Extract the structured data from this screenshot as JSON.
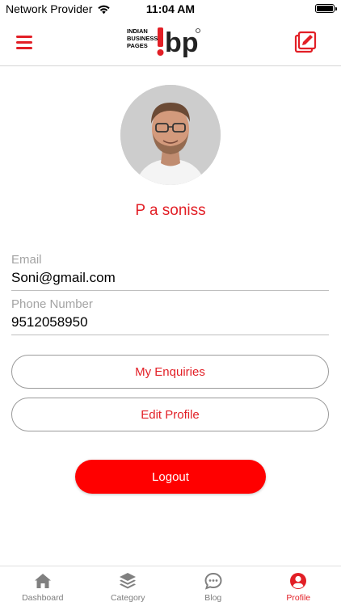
{
  "status_bar": {
    "carrier": "Network Provider",
    "time": "11:04 AM"
  },
  "header": {
    "logo_text_small": [
      "INDIAN",
      "BUSINESS",
      "PAGES"
    ],
    "logo_text_big": "!bp",
    "menu_icon": "hamburger-menu-icon",
    "edit_icon": "edit-square-icon",
    "brand_color": "#e21f26"
  },
  "profile": {
    "name": "P a soniss",
    "email_label": "Email",
    "email_value": "Soni@gmail.com",
    "phone_label": "Phone Number",
    "phone_value": "9512058950"
  },
  "buttons": {
    "enquiries": "My Enquiries",
    "edit_profile": "Edit Profile",
    "logout": "Logout",
    "logout_color": "#ff0000"
  },
  "tabs": [
    {
      "label": "Dashboard",
      "icon": "home-icon"
    },
    {
      "label": "Category",
      "icon": "layers-icon"
    },
    {
      "label": "Blog",
      "icon": "chat-bubble-icon"
    },
    {
      "label": "Profile",
      "icon": "user-circle-icon",
      "active": true
    }
  ]
}
